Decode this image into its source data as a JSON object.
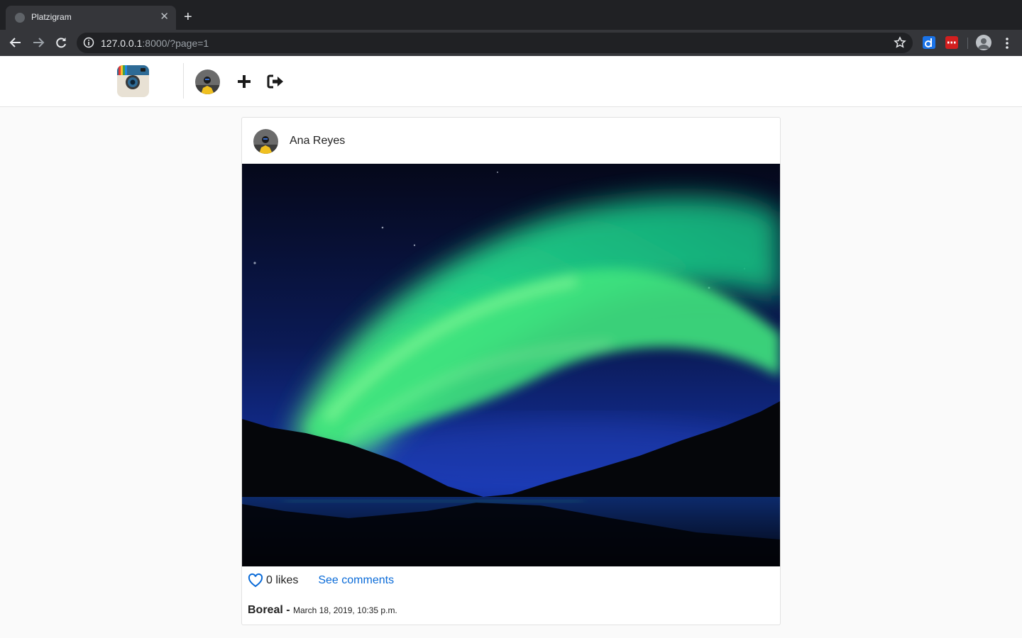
{
  "browser": {
    "tab_title": "Platzigram",
    "url_host": "127.0.0.1",
    "url_rest": ":8000/?page=1"
  },
  "post": {
    "author": "Ana Reyes",
    "likes": "0 likes",
    "see_comments": "See comments",
    "title": "Boreal",
    "separator": " - ",
    "date": "March 18, 2019, 10:35 p.m."
  },
  "icons": {
    "favicon": "globe-icon",
    "close": "close-icon",
    "new_tab": "plus-icon",
    "back": "arrow-left-icon",
    "forward": "arrow-right-icon",
    "reload": "reload-icon",
    "info": "info-icon",
    "bookmark": "star-icon",
    "new_post": "plus-icon",
    "logout": "sign-out-icon",
    "like": "heart-icon"
  },
  "colors": {
    "link": "#0a6bd8",
    "chrome_dark": "#202124",
    "chrome_toolbar": "#35363a"
  }
}
